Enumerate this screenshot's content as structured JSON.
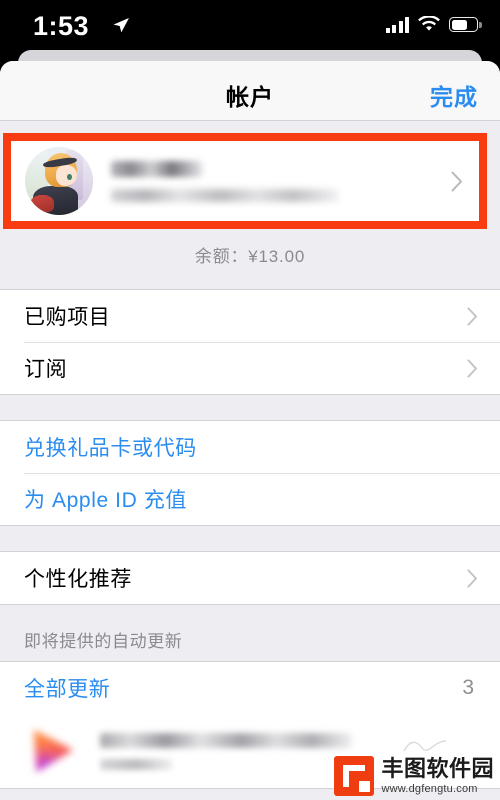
{
  "statusbar": {
    "time": "1:53",
    "location_icon": "location-arrow-icon",
    "signal_icon": "cellular-signal-icon",
    "wifi_icon": "wifi-icon",
    "battery_icon": "battery-icon",
    "battery_level_pct": 62
  },
  "navbar": {
    "title": "帐户",
    "done_label": "完成"
  },
  "profile": {
    "name_redacted": "",
    "email_redacted": "",
    "avatar_name": "user-avatar",
    "highlight_color": "#f93b12",
    "chevron_icon": "chevron-right-icon"
  },
  "balance": {
    "text": "余额：¥13.00"
  },
  "account_group": {
    "items": [
      {
        "label": "已购项目",
        "chevron_icon": "chevron-right-icon"
      },
      {
        "label": "订阅",
        "chevron_icon": "chevron-right-icon"
      }
    ]
  },
  "payment_group": {
    "items": [
      {
        "label": "兑换礼品卡或代码"
      },
      {
        "label": "为 Apple ID 充值"
      }
    ]
  },
  "recommend_group": {
    "items": [
      {
        "label": "个性化推荐",
        "chevron_icon": "chevron-right-icon"
      }
    ]
  },
  "updates": {
    "section_header": "即将提供的自动更新",
    "update_all_label": "全部更新",
    "update_all_count": "3",
    "app_row": {
      "icon_name": "video-app-icon",
      "title_redacted": "",
      "subtitle_redacted": ""
    }
  },
  "watermark": {
    "name": "丰图软件园",
    "url": "www.dgfengtu.com",
    "logo_color": "#ef3d11"
  },
  "colors": {
    "accent_blue": "#2b8cf0",
    "highlight_red": "#f93b12",
    "background_gray": "#eeeef2",
    "row_white": "#ffffff",
    "secondary_text": "#8a8a8f"
  }
}
